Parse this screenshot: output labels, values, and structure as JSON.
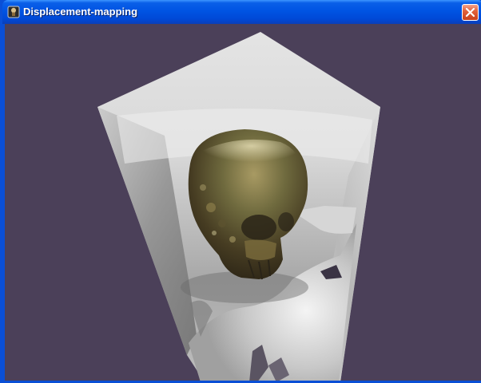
{
  "window": {
    "title": "Displacement-mapping",
    "app_icon": "app-icon",
    "close_icon": "close-icon"
  },
  "viewport": {
    "background_color": "#4b4059",
    "scene": "3D rendering of a textured skull inside a grey box"
  }
}
